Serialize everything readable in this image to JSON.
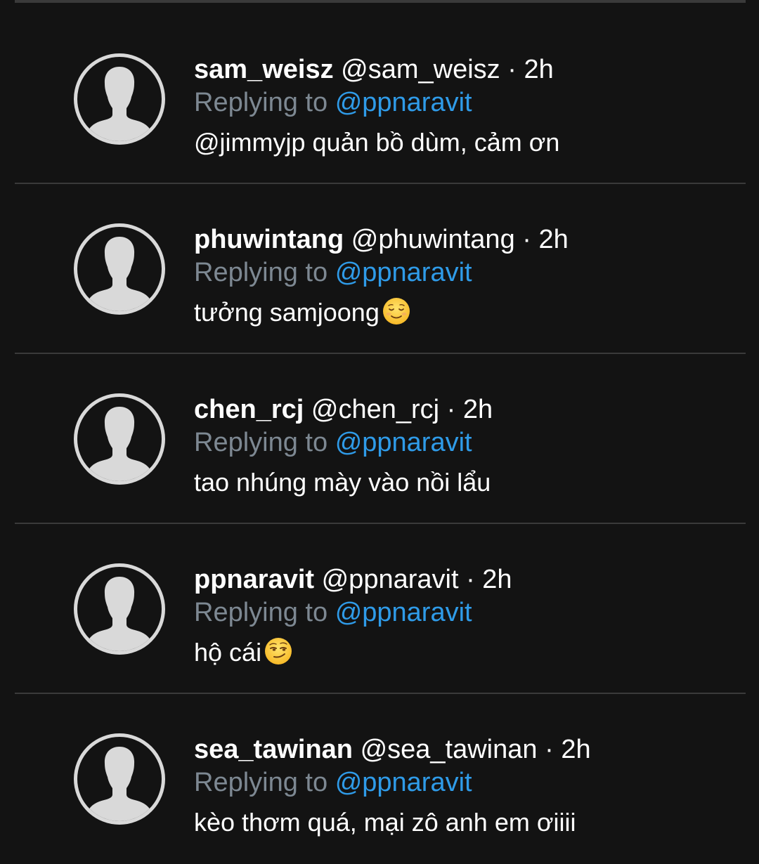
{
  "replying_prefix": "Replying to",
  "replies": [
    {
      "display_name": "sam_weisz",
      "handle": "@sam_weisz",
      "separator": "·",
      "time": "2h",
      "replying_to": "@ppnaravit",
      "text": "@jimmyjp quản bồ dùm, cảm ơn",
      "emoji": ""
    },
    {
      "display_name": "phuwintang",
      "handle": "@phuwintang",
      "separator": "·",
      "time": "2h",
      "replying_to": "@ppnaravit",
      "text": "tưởng samjoong",
      "emoji": "relieved-face"
    },
    {
      "display_name": "chen_rcj",
      "handle": "@chen_rcj",
      "separator": "·",
      "time": "2h",
      "replying_to": "@ppnaravit",
      "text": "tao nhúng mày vào nồi lẩu",
      "emoji": ""
    },
    {
      "display_name": "ppnaravit",
      "handle": "@ppnaravit",
      "separator": "·",
      "time": "2h",
      "replying_to": "@ppnaravit",
      "text": "hộ cái",
      "emoji": "smirking-face"
    },
    {
      "display_name": "sea_tawinan",
      "handle": "@sea_tawinan",
      "separator": "·",
      "time": "2h",
      "replying_to": "@ppnaravit",
      "text": "kèo thơm quá, mại zô anh em ơiiii",
      "emoji": ""
    }
  ],
  "colors": {
    "background": "#131313",
    "divider": "#3a3a3a",
    "secondary_text": "#7d8892",
    "link": "#2f9be8",
    "avatar_ring": "#d9d9d9"
  }
}
